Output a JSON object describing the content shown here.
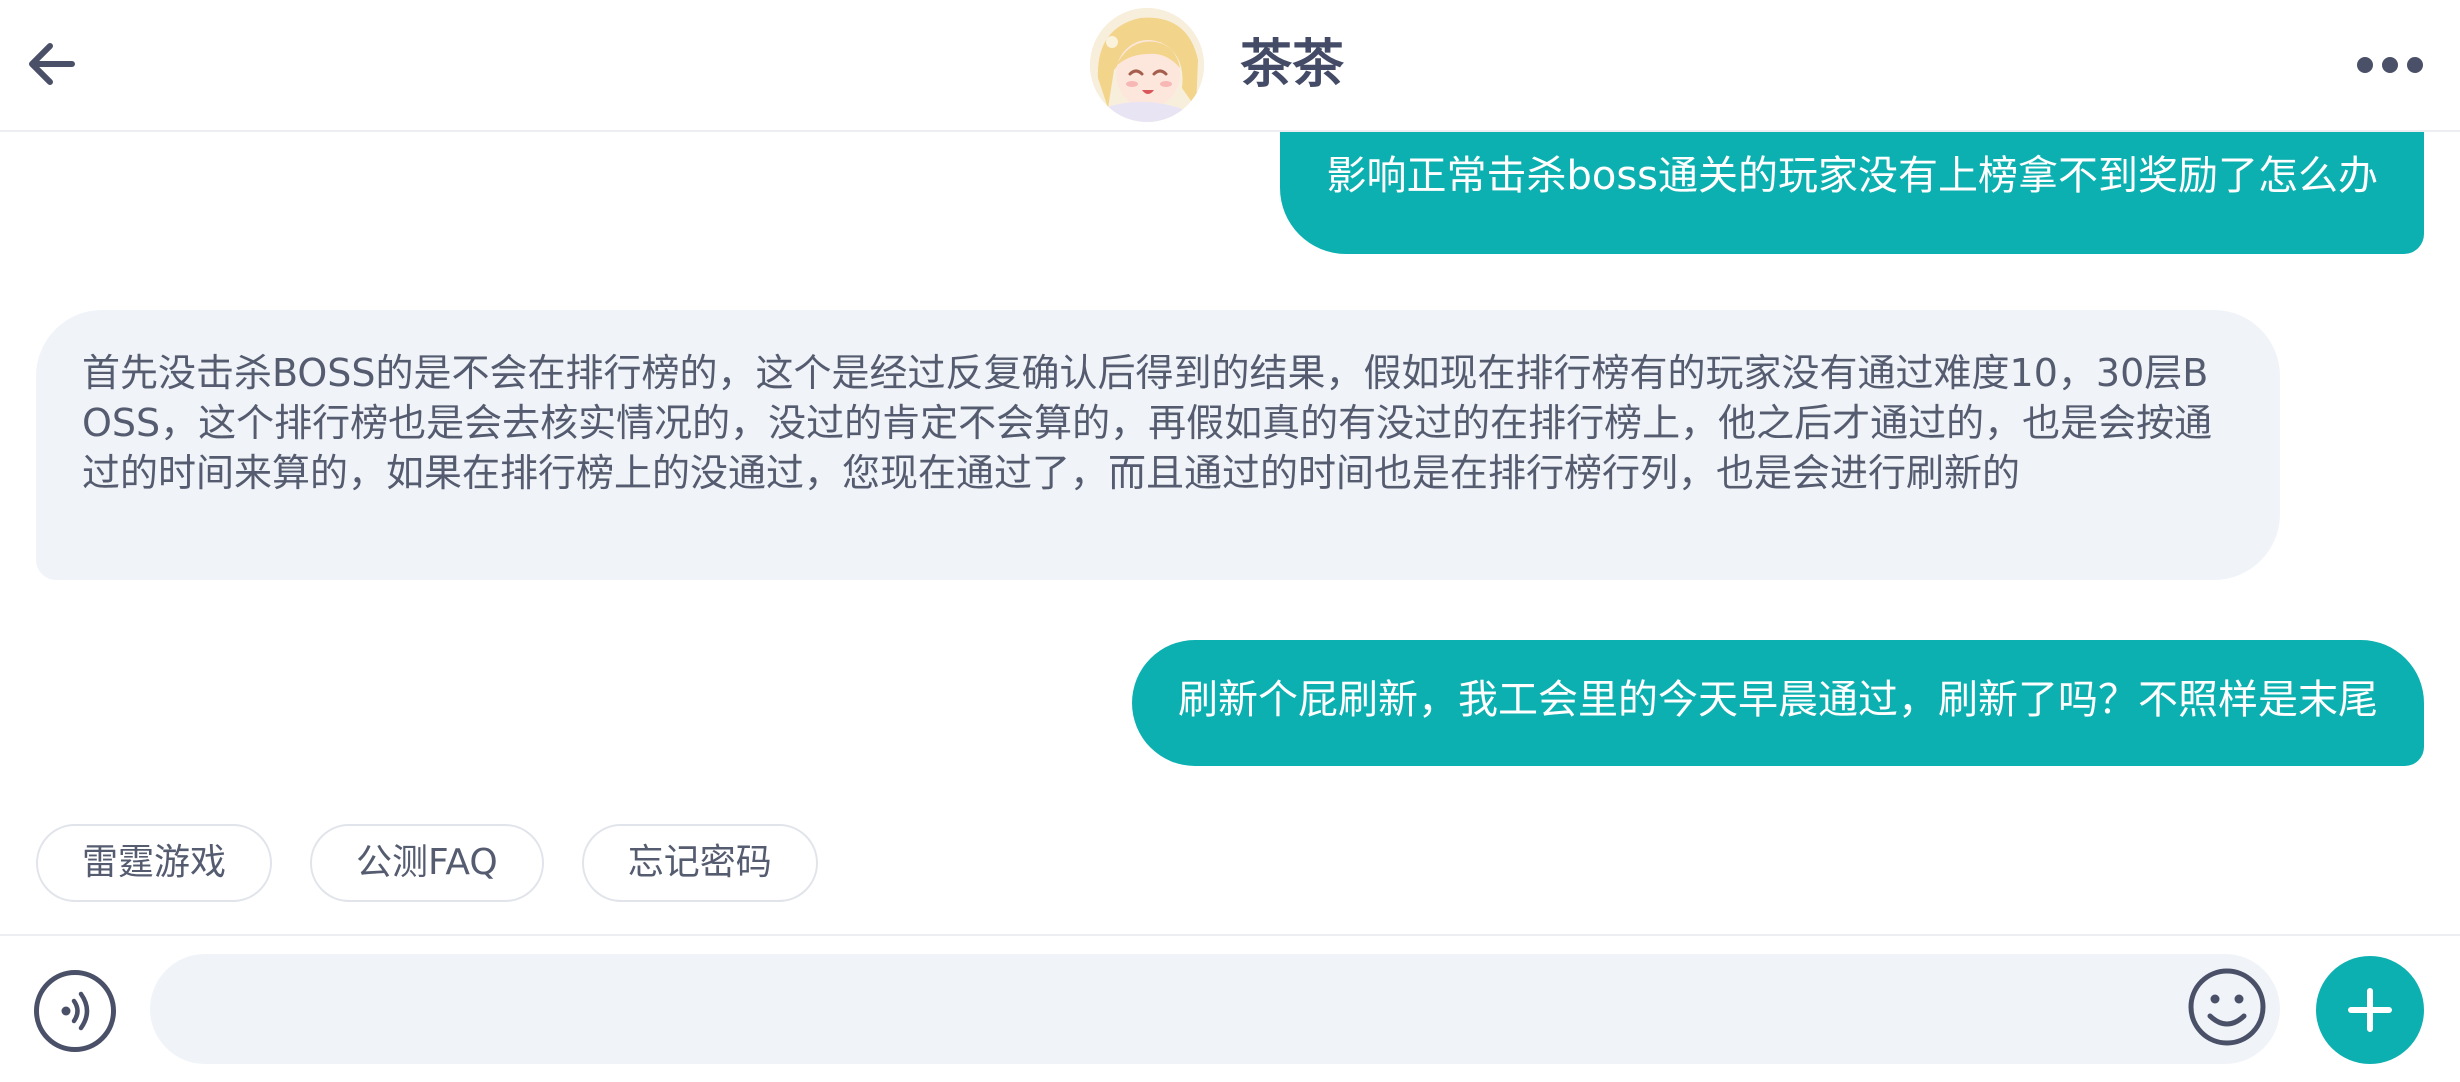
{
  "header": {
    "back_icon": "arrow-left-icon",
    "contact_name": "茶茶",
    "avatar_icon": "anime-girl-avatar",
    "more_icon": "more-dots-icon"
  },
  "messages": [
    {
      "direction": "outgoing",
      "text": "影响正常击杀boss通关的玩家没有上榜拿不到奖励了怎么办"
    },
    {
      "direction": "incoming",
      "text": "首先没击杀BOSS的是不会在排行榜的，这个是经过反复确认后得到的结果，假如现在排行榜有的玩家没有通过难度10，30层BOSS，这个排行榜也是会去核实情况的，没过的肯定不会算的，再假如真的有没过的在排行榜上，他之后才通过的，也是会按通过的时间来算的，如果在排行榜上的没通过，您现在通过了，而且通过的时间也是在排行榜行列，也是会进行刷新的"
    },
    {
      "direction": "outgoing",
      "text": "刷新个屁刷新，我工会里的今天早晨通过，刷新了吗？不照样是末尾"
    }
  ],
  "quick_replies": [
    "雷霆游戏",
    "公测FAQ",
    "忘记密码"
  ],
  "composer": {
    "voice_icon": "voice-input-icon",
    "input_value": "",
    "input_placeholder": "",
    "emoji_icon": "emoji-icon",
    "plus_icon": "plus-icon"
  },
  "colors": {
    "accent": "#0db0b0",
    "incoming_bubble": "#f0f3f8",
    "text_dark": "#444b66"
  }
}
